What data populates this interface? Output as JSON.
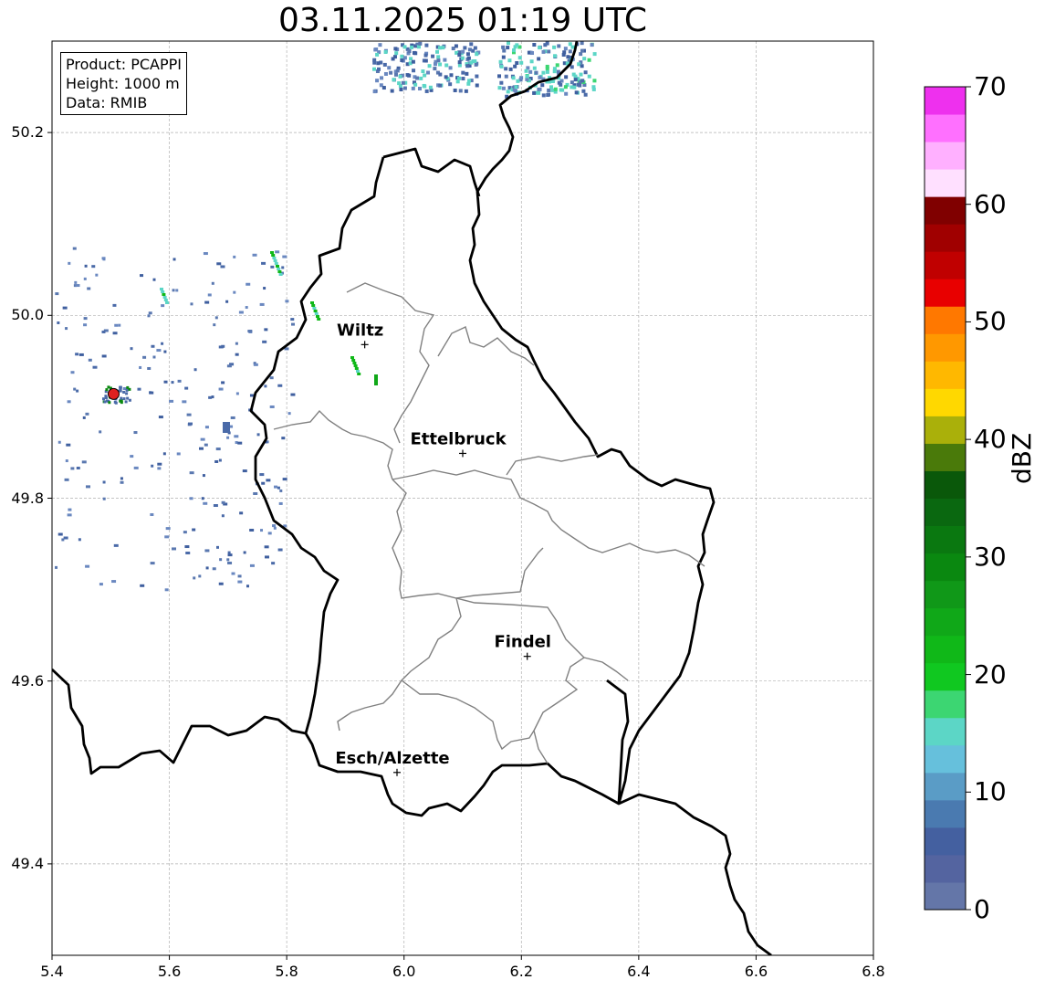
{
  "title": "03.11.2025 01:19 UTC",
  "info": {
    "product": "Product: PCAPPI",
    "height": "Height: 1000 m",
    "source": "Data: RMIB"
  },
  "map": {
    "lon_range": [
      5.4,
      6.8
    ],
    "lat_range": [
      49.3,
      50.3
    ],
    "grid": true,
    "x_ticks": [
      "5.4",
      "5.6",
      "5.8",
      "6.0",
      "6.2",
      "6.4",
      "6.6",
      "6.8"
    ],
    "y_ticks": [
      "49.4",
      "49.6",
      "49.8",
      "50.0",
      "50.2"
    ],
    "radar_site": {
      "lon": 5.505,
      "lat": 49.914,
      "color": "#e02020"
    },
    "cities": [
      {
        "name": "Wiltz",
        "lon": 5.933,
        "lat": 49.968
      },
      {
        "name": "Ettelbruck",
        "lon": 6.1,
        "lat": 49.849
      },
      {
        "name": "Findel",
        "lon": 6.21,
        "lat": 49.627
      },
      {
        "name": "Esch/Alzette",
        "lon": 5.988,
        "lat": 49.5
      }
    ]
  },
  "colorbar": {
    "label": "dBZ",
    "ticks": [
      "0",
      "10",
      "20",
      "30",
      "40",
      "50",
      "60",
      "70"
    ],
    "colors": [
      "#6476a8",
      "#5464a0",
      "#4460a0",
      "#4a7ab0",
      "#5a9cc6",
      "#66c0dc",
      "#5cd6c6",
      "#3cd672",
      "#10c820",
      "#10b818",
      "#10a818",
      "#109818",
      "#0a8810",
      "#0a7810",
      "#0a6810",
      "#0a580a",
      "#4a7a0a",
      "#aab00a",
      "#ffd800",
      "#ffb800",
      "#ff9800",
      "#ff7800",
      "#e80000",
      "#c00000",
      "#a00000",
      "#800000",
      "#ffe0ff",
      "#ffb0ff",
      "#ff70ff",
      "#ee30ee"
    ]
  }
}
